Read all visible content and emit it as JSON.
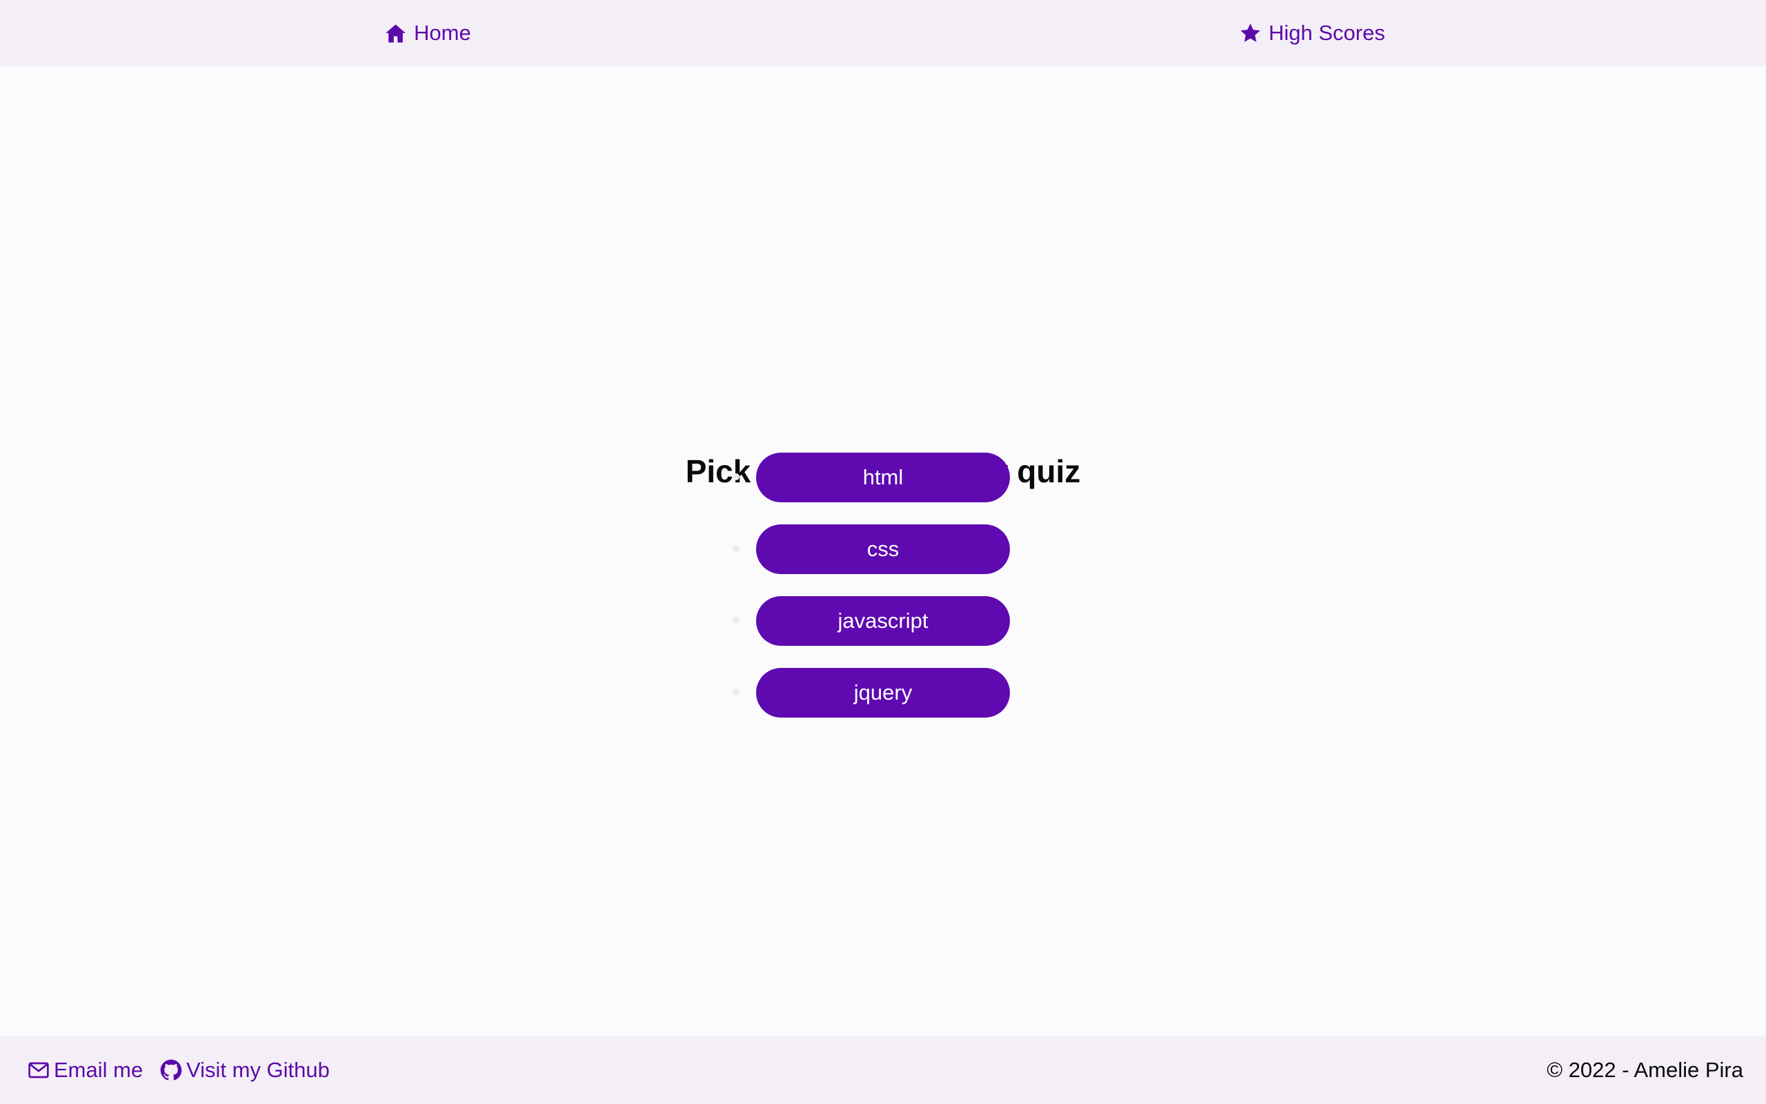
{
  "nav": {
    "home": {
      "label": "Home",
      "icon": "home-icon"
    },
    "high_scores": {
      "label": "High Scores",
      "icon": "star-icon"
    }
  },
  "main": {
    "title": "Pick a theme for your quiz",
    "themes": [
      {
        "label": "html"
      },
      {
        "label": "css"
      },
      {
        "label": "javascript"
      },
      {
        "label": "jquery"
      }
    ]
  },
  "footer": {
    "email": {
      "label": "Email me",
      "icon": "envelope-icon"
    },
    "github": {
      "label": "Visit my Github",
      "icon": "github-icon"
    },
    "copyright": "© 2022 - Amelie Pira"
  },
  "colors": {
    "accent": "#5e0ab0",
    "bar_background": "#f4eff7",
    "page_background": "#fbfbfd"
  }
}
